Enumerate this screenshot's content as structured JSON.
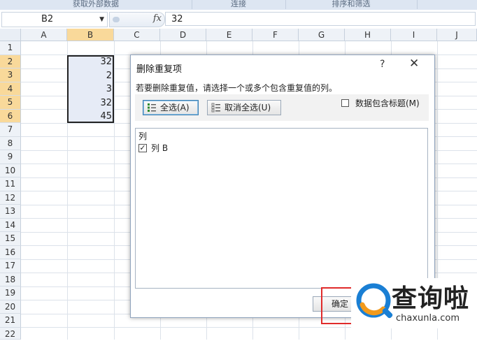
{
  "ribbon": {
    "groups": [
      "获取外部数据",
      "连接",
      "排序和筛选"
    ]
  },
  "formula_bar": {
    "name_box": "B2",
    "fx_label": "fx",
    "value": "32"
  },
  "sheet": {
    "columns": [
      "A",
      "B",
      "C",
      "D",
      "E",
      "F",
      "G",
      "H",
      "I",
      "J"
    ],
    "rows": [
      "1",
      "2",
      "3",
      "4",
      "5",
      "6",
      "7",
      "8",
      "9",
      "10",
      "11",
      "12",
      "13",
      "14",
      "15",
      "16",
      "17",
      "18",
      "19",
      "20",
      "21",
      "22"
    ],
    "b_values": [
      "32",
      "2",
      "3",
      "32",
      "45"
    ]
  },
  "dialog": {
    "title": "删除重复项",
    "help": "?",
    "close": "✕",
    "instruction": "若要删除重复值，请选择一个或多个包含重复值的列。",
    "select_all": "全选(A)",
    "unselect_all": "取消全选(U)",
    "header_option": "数据包含标题(M)",
    "header_checked": false,
    "list_header": "列",
    "list_items": [
      {
        "label": "列 B",
        "checked": true
      }
    ],
    "ok": "确定"
  },
  "watermark": {
    "brand": "查询啦",
    "url": "chaxunla.com"
  },
  "colors": {
    "selection_header": "#f9d99a",
    "selection_fill": "#e6ebf6",
    "highlight_box": "#e02b2b",
    "watermark_blue": "#1a7fd4",
    "watermark_orange": "#f29a1c"
  }
}
